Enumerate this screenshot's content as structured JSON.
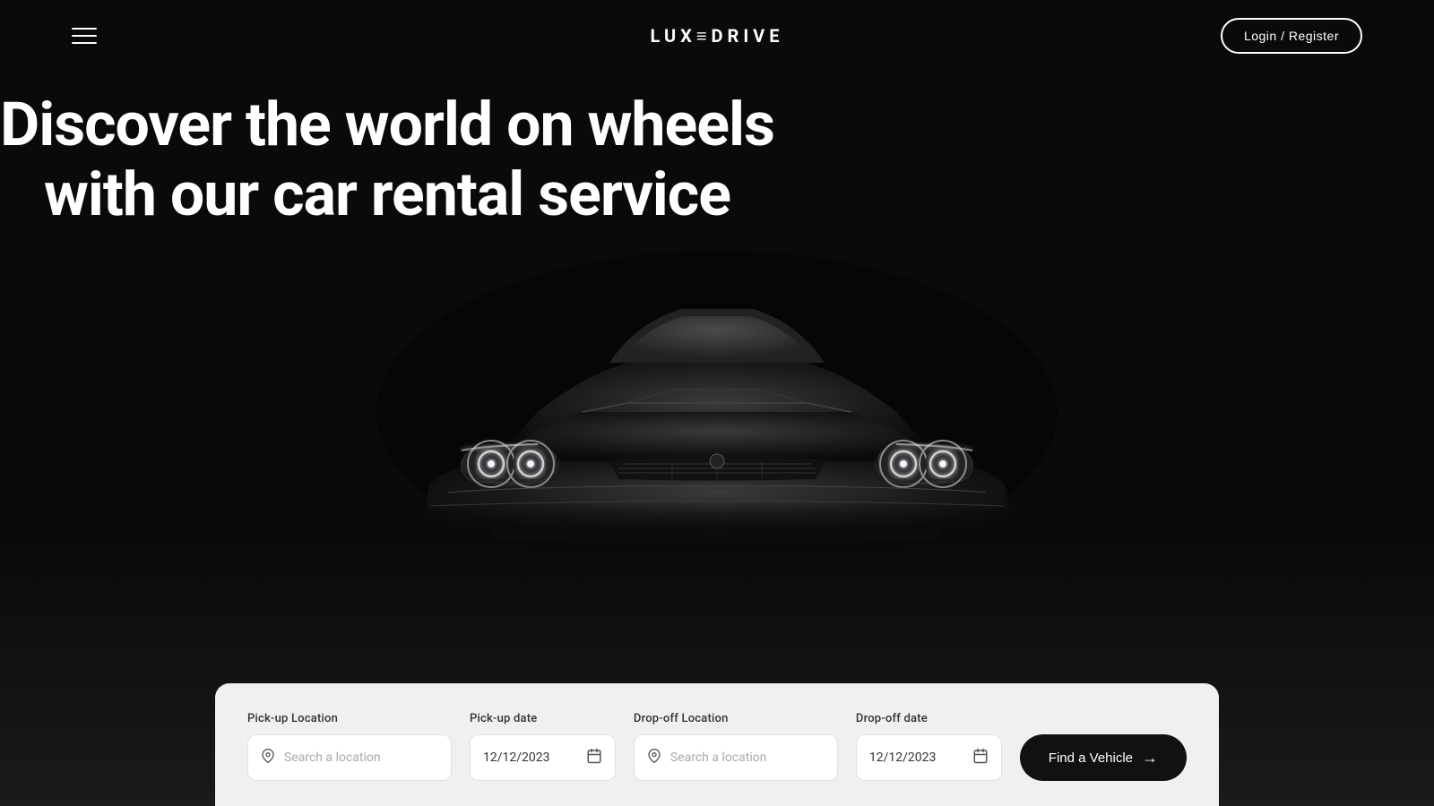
{
  "header": {
    "logo": "LUX≡DRIVE",
    "login_label": "Login / Register"
  },
  "hero": {
    "title_line1": "Discover the world on wheels",
    "title_line2": "with our car rental service"
  },
  "search": {
    "pickup_location_label": "Pick-up Location",
    "pickup_location_placeholder": "Search a location",
    "pickup_date_label": "Pick-up date",
    "pickup_date_value": "12/12/2023",
    "dropoff_location_label": "Drop-off Location",
    "dropoff_location_placeholder": "Search a location",
    "dropoff_date_label": "Drop-off date",
    "dropoff_date_value": "12/12/2023",
    "find_button_label": "Find a Vehicle"
  },
  "colors": {
    "background": "#0a0a0a",
    "panel_bg": "#f0f0f0",
    "button_bg": "#111111",
    "text_primary": "#ffffff",
    "text_muted": "#aaaaaa"
  }
}
